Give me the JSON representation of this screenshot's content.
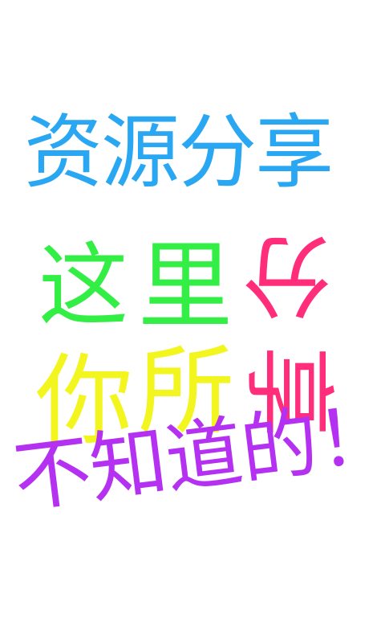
{
  "title": {
    "text": "资源分享",
    "color": "#2aa7f2"
  },
  "line2": {
    "char1": {
      "text": "这",
      "color": "#33ee44"
    },
    "char2": {
      "text": "里",
      "color": "#33ee44"
    },
    "char3": {
      "text": "分",
      "color": "#ff2d7a"
    }
  },
  "line3": {
    "char1": {
      "text": "你",
      "color": "#f3f51f"
    },
    "char2": {
      "text": "所",
      "color": "#f3f51f"
    },
    "char3": {
      "text": "享",
      "color": "#ff2d7a"
    }
  },
  "bottom": {
    "text": "不知道的！",
    "color": "#b531f2"
  }
}
